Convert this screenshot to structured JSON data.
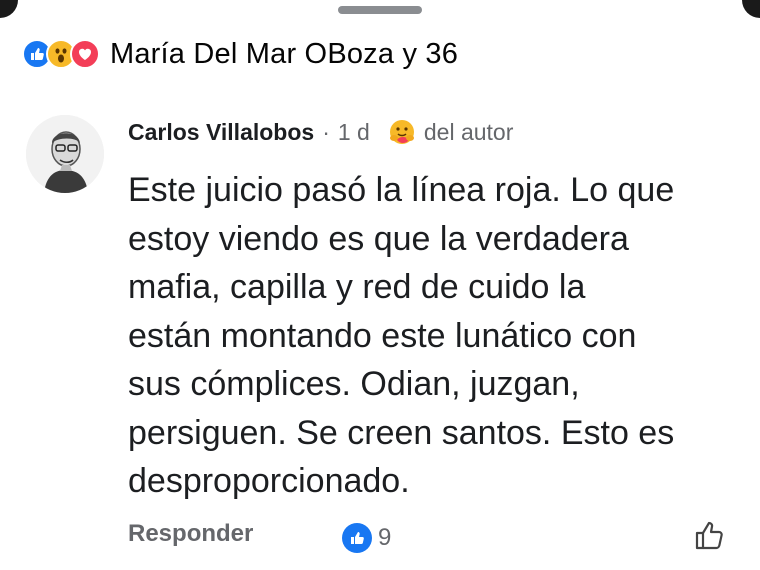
{
  "reactions": {
    "icons": [
      "like-icon",
      "wow-icon",
      "love-icon"
    ],
    "summary": "María Del Mar OBoza y 36"
  },
  "comment": {
    "author": "Carlos Villalobos",
    "separator": "·",
    "time": "1 d",
    "badge_icon": "hug-emoji-icon",
    "badge": "del autor",
    "text": "Este juicio pasó la línea roja. Lo que\nestoy viendo es que la verdadera\nmafia, capilla y red de cuido la\nestán montando este lunático con\nsus cómplices.  Odian, juzgan,\npersiguen. Se creen santos. Esto es\ndesproporcionado.",
    "reply_label": "Responder",
    "like_count": "9"
  },
  "colors": {
    "like_blue": "#1877f2",
    "wow_yellow": "#f7b928",
    "love_red": "#f33e58",
    "secondary_text": "#65676b"
  }
}
